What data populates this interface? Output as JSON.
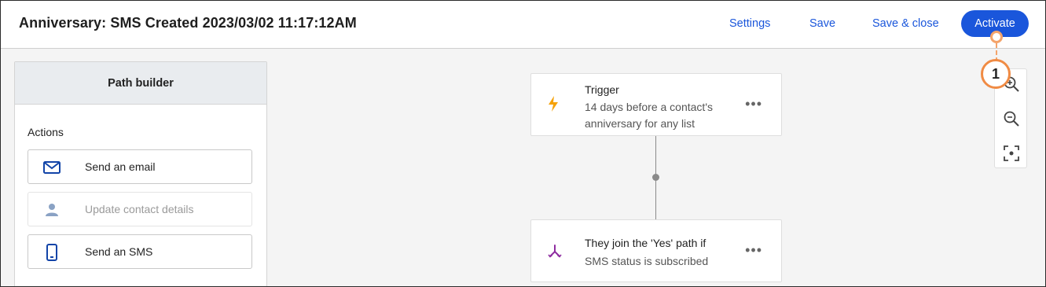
{
  "header": {
    "title": "Anniversary: SMS Created 2023/03/02 11:17:12AM",
    "links": {
      "settings": "Settings",
      "save": "Save",
      "save_close": "Save & close"
    },
    "activate": "Activate",
    "accent_color": "#1a56db"
  },
  "callout": {
    "number": "1",
    "color": "#f08b44"
  },
  "path_builder": {
    "title": "Path builder",
    "actions_label": "Actions",
    "actions": [
      {
        "label": "Send an email",
        "icon": "envelope-icon",
        "enabled": true
      },
      {
        "label": "Update contact details",
        "icon": "person-icon",
        "enabled": false
      },
      {
        "label": "Send an SMS",
        "icon": "phone-icon",
        "enabled": true
      }
    ]
  },
  "canvas": {
    "trigger": {
      "title": "Trigger",
      "description": [
        "14 days before a contact's",
        "anniversary for any list"
      ],
      "icon": "lightning-icon",
      "icon_color": "#f5a20a"
    },
    "condition": {
      "title": "They join the 'Yes' path if",
      "description": "SMS status is subscribed",
      "icon": "split-icon",
      "icon_color": "#8e2da0"
    },
    "more_glyph": "•••"
  },
  "zoom_controls": [
    "zoom-in-icon",
    "zoom-out-icon",
    "fit-screen-icon"
  ]
}
